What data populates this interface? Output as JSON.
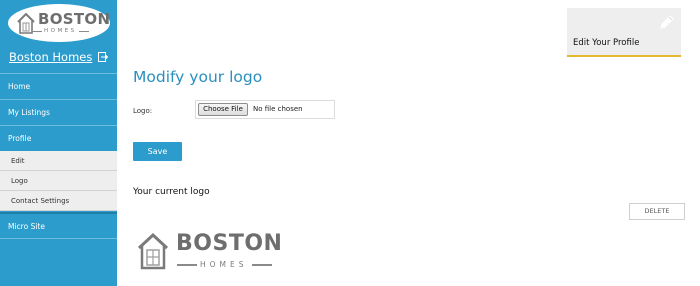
{
  "brand": {
    "logo_word": "BOSTON",
    "logo_sub": "HOMES"
  },
  "sidebar": {
    "account_name": "Boston Homes",
    "items": [
      {
        "label": "Home"
      },
      {
        "label": "My Listings"
      },
      {
        "label": "Profile"
      }
    ],
    "profile_subitems": [
      {
        "label": "Edit"
      },
      {
        "label": "Logo"
      },
      {
        "label": "Contact Settings"
      }
    ],
    "micro_site_label": "Micro Site"
  },
  "main": {
    "heading": "Modify your logo",
    "logo_field_label": "Logo:",
    "choose_file_label": "Choose File",
    "file_status": "No file chosen",
    "save_label": "Save",
    "current_logo_title": "Your current logo",
    "delete_label": "DELETE",
    "current_logo": {
      "word": "BOSTON",
      "sub": "HOMES"
    }
  },
  "profile_card": {
    "label": "Edit Your Profile",
    "icon": "pencil-icon"
  },
  "colors": {
    "sidebar_bg": "#2b9ccb",
    "accent_heading": "#2b8fbe",
    "card_underline": "#e4b92f"
  }
}
